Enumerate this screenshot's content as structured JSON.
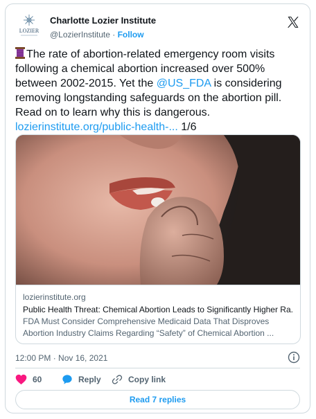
{
  "author": {
    "name": "Charlotte Lozier Institute",
    "handle": "@LozierInstitute",
    "separator": "·",
    "follow_label": "Follow",
    "avatar_text": "LOZIER"
  },
  "tweet": {
    "text_part1": "The rate of abortion-related emergency room visits following a chemical abortion increased over 500% between 2002-2015. Yet the ",
    "mention": "@US_FDA",
    "text_part2": " is considering removing longstanding safeguards on the abortion pill. Read on to learn why this is dangerous. ",
    "link": "lozierinstitute.org/public-health-...",
    "thread_count": "1/6"
  },
  "link_card": {
    "domain": "lozierinstitute.org",
    "title": "Public Health Threat: Chemical Abortion Leads to Significantly Higher Ra...",
    "description": "FDA Must Consider Comprehensive Medicaid Data That Disproves Abortion Industry Claims Regarding “Safety” of Chemical Abortion ..."
  },
  "meta": {
    "timestamp": "12:00 PM · Nov 16, 2021"
  },
  "actions": {
    "like_count": "60",
    "reply_label": "Reply",
    "copy_link_label": "Copy link"
  },
  "replies_button": "Read 7 replies",
  "colors": {
    "accent": "#1d9bf0",
    "like": "#f91880",
    "text": "#0f1419",
    "muted": "#536471",
    "border": "#cfd9de"
  },
  "icons": [
    "thread-icon",
    "x-logo-icon",
    "info-icon",
    "heart-icon",
    "reply-icon",
    "link-icon"
  ]
}
